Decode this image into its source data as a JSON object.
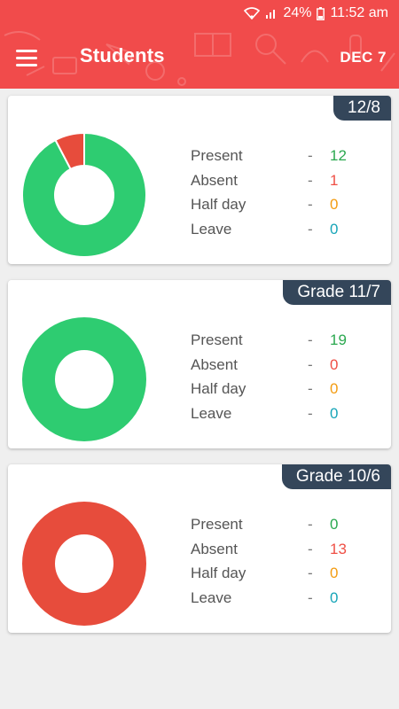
{
  "status_bar": {
    "battery": "24%",
    "time": "11:52 am"
  },
  "app_bar": {
    "title": "Students",
    "date": "DEC 7"
  },
  "colors": {
    "present": "#2ecc71",
    "absent": "#e74c3c",
    "half_day": "#f39c12",
    "leave": "#17a5b8"
  },
  "cards": [
    {
      "grade": "12/8",
      "stats": [
        {
          "label": "Present",
          "dash": "-",
          "value": "12"
        },
        {
          "label": "Absent",
          "dash": "-",
          "value": "1"
        },
        {
          "label": "Half day",
          "dash": "-",
          "value": "0"
        },
        {
          "label": "Leave",
          "dash": "-",
          "value": "0"
        }
      ],
      "chart_values": [
        12,
        1,
        0,
        0
      ]
    },
    {
      "grade": "Grade 11/7",
      "stats": [
        {
          "label": "Present",
          "dash": "-",
          "value": "19"
        },
        {
          "label": "Absent",
          "dash": "-",
          "value": "0"
        },
        {
          "label": "Half day",
          "dash": "-",
          "value": "0"
        },
        {
          "label": "Leave",
          "dash": "-",
          "value": "0"
        }
      ],
      "chart_values": [
        19,
        0,
        0,
        0
      ]
    },
    {
      "grade": "Grade 10/6",
      "stats": [
        {
          "label": "Present",
          "dash": "-",
          "value": "0"
        },
        {
          "label": "Absent",
          "dash": "-",
          "value": "13"
        },
        {
          "label": "Half day",
          "dash": "-",
          "value": "0"
        },
        {
          "label": "Leave",
          "dash": "-",
          "value": "0"
        }
      ],
      "chart_values": [
        0,
        13,
        0,
        0
      ]
    }
  ]
}
